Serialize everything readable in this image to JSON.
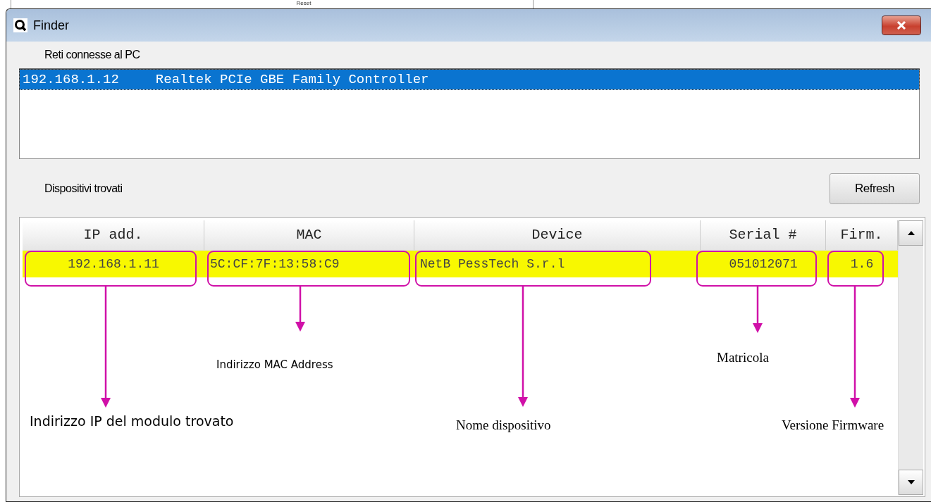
{
  "background_window": {
    "text": "Reset"
  },
  "window": {
    "title": "Finder"
  },
  "networks": {
    "label": "Reti connesse al PC",
    "items": [
      {
        "ip": "192.168.1.12",
        "adapter": "Realtek PCIe GBE Family Controller",
        "selected": true
      }
    ]
  },
  "devices": {
    "label": "Dispositivi trovati",
    "refresh_button": "Refresh",
    "columns": [
      "IP add.",
      "MAC",
      "Device",
      "Serial #",
      "Firm."
    ],
    "rows": [
      {
        "cells": [
          "192.168.1.11",
          "5C:CF:7F:13:58:C9",
          "NetB PessTech S.r.l",
          "051012071",
          "1.6"
        ],
        "highlighted": true
      }
    ]
  },
  "annotations": [
    "Indirizzo IP del modulo trovato",
    "Indirizzo MAC Address",
    "Nome dispositivo",
    "Matricola",
    "Versione Firmware"
  ]
}
